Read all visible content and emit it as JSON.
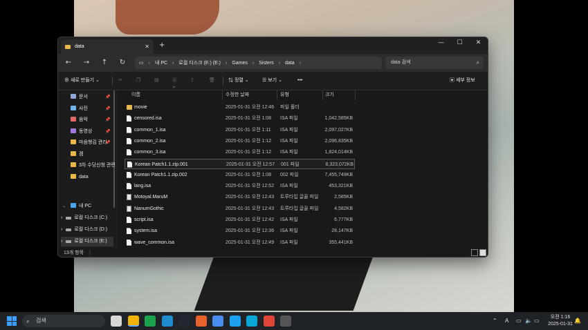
{
  "window": {
    "tab_title": "data",
    "tab_close": "✕",
    "new_tab": "+",
    "controls": [
      "—",
      "☐",
      "✕"
    ]
  },
  "address": {
    "breadcrumbs": [
      "내 PC",
      "로컬 디스크 (E:) (E:)",
      "Games",
      "Sisters",
      "data"
    ],
    "search_placeholder": "data 검색"
  },
  "toolbar": {
    "new_label": "새로 만들기",
    "sort_label": "정렬",
    "view_label": "보기",
    "more_label": "•••",
    "details_label": "세부 정보"
  },
  "nav_pane": {
    "quick": [
      {
        "label": "문서",
        "color": "#8fa8d8",
        "pinned": true
      },
      {
        "label": "사진",
        "color": "#6fb0e8",
        "pinned": true
      },
      {
        "label": "음악",
        "color": "#e06a6a",
        "pinned": true
      },
      {
        "label": "동영상",
        "color": "#a07ae0",
        "pinned": true
      },
      {
        "label": "마음챙김 관리",
        "color": "#e8b84a",
        "pinned": true
      },
      {
        "label": "겜",
        "color": "#e8b84a",
        "pinned": false
      },
      {
        "label": "3차 수당신청 관련",
        "color": "#e8b84a",
        "pinned": false
      },
      {
        "label": "data",
        "color": "#e8b84a",
        "pinned": false
      }
    ],
    "pc_label": "내 PC",
    "drives": [
      "로컬 디스크 (C:)",
      "로컬 디스크 (D:)",
      "로컬 디스크 (E:)"
    ]
  },
  "columns": {
    "name": "이름",
    "date": "수정한 날짜",
    "type": "유형",
    "size": "크기"
  },
  "files": [
    {
      "name": "movie",
      "date": "2025-01-31 오전 12:46",
      "type": "파일 폴더",
      "size": "",
      "kind": "folder"
    },
    {
      "name": "censored.isa",
      "date": "2025-01-31 오전 1:08",
      "type": "ISA 파일",
      "size": "1,042,585KB",
      "kind": "file"
    },
    {
      "name": "common_1.isa",
      "date": "2025-01-31 오전 1:11",
      "type": "ISA 파일",
      "size": "2,097,027KB",
      "kind": "file"
    },
    {
      "name": "common_2.isa",
      "date": "2025-01-31 오전 1:12",
      "type": "ISA 파일",
      "size": "2,096,835KB",
      "kind": "file"
    },
    {
      "name": "common_3.isa",
      "date": "2025-01-31 오전 1:12",
      "type": "ISA 파일",
      "size": "1,824,014KB",
      "kind": "file"
    },
    {
      "name": "Korean Patch1.1.zip.001",
      "date": "2025-01-31 오전 12:57",
      "type": "001 파일",
      "size": "8,323,072KB",
      "kind": "file",
      "highlight": true
    },
    {
      "name": "Korean Patch1.1.zip.002",
      "date": "2025-01-31 오전 1:08",
      "type": "002 파일",
      "size": "7,455,749KB",
      "kind": "file"
    },
    {
      "name": "lang.isa",
      "date": "2025-01-31 오전 12:52",
      "type": "ISA 파일",
      "size": "453,321KB",
      "kind": "file"
    },
    {
      "name": "Motoyal.MaruM",
      "date": "2025-01-31 오전 12:43",
      "type": "트루타입 글꼴 파일",
      "size": "2,585KB",
      "kind": "font"
    },
    {
      "name": "NanumGothic",
      "date": "2025-01-31 오전 12:43",
      "type": "트루타입 글꼴 파일",
      "size": "4,582KB",
      "kind": "font"
    },
    {
      "name": "script.isa",
      "date": "2025-01-31 오전 12:42",
      "type": "ISA 파일",
      "size": "6,777KB",
      "kind": "file"
    },
    {
      "name": "system.isa",
      "date": "2025-01-31 오전 12:36",
      "type": "ISA 파일",
      "size": "28,147KB",
      "kind": "file"
    },
    {
      "name": "wave_common.isa",
      "date": "2025-01-31 오전 12:49",
      "type": "ISA 파일",
      "size": "355,441KB",
      "kind": "file"
    }
  ],
  "status": {
    "count": "13개 항목"
  },
  "taskbar": {
    "search_label": "검색",
    "ime": "A",
    "time": "오전 1:16",
    "date": "2025-01-31",
    "app_colors": [
      "#d8d8d8",
      "#f0b400",
      "#1aa34a",
      "#1f8ccf",
      "#222831",
      "#e8632b",
      "#4a8df0",
      "#1da1f2",
      "#0aa6d8",
      "#e0453a",
      "#555"
    ]
  }
}
